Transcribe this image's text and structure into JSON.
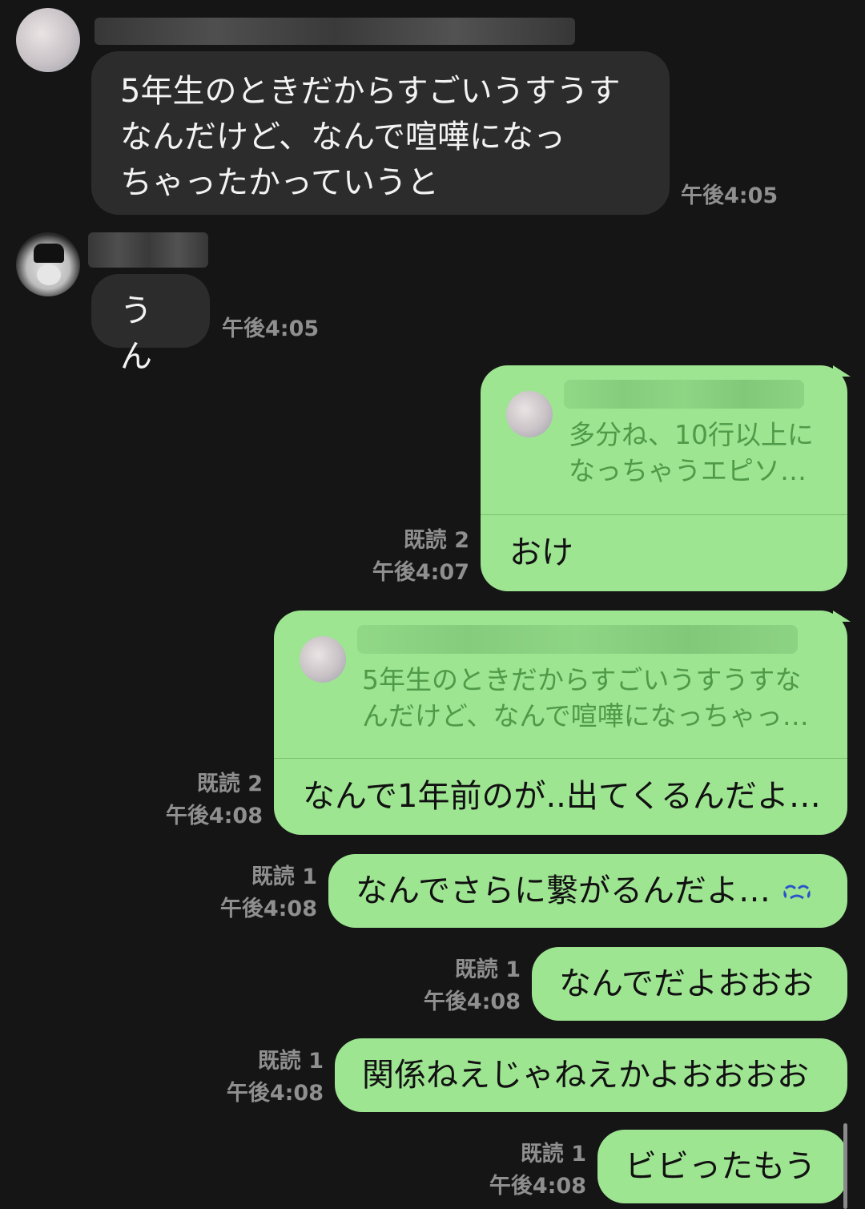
{
  "messages_in": [
    {
      "text": "5年生のときだからすごいうすうす\nなんだけど、なんで喧嘩になっ\nちゃったかっていうと",
      "time": "午後4:05"
    },
    {
      "text": "うん",
      "time": "午後4:05"
    }
  ],
  "messages_out": [
    {
      "quote": "多分ね、10行以上に\nなっちゃうエピソ…",
      "text": "おけ",
      "read": "既読 2",
      "time": "午後4:07"
    },
    {
      "quote": "5年生のときだからすごいうすうすな\nんだけど、なんで喧嘩になっちゃっ…",
      "text": "なんで1年前のが..出てくるんだよ…",
      "read": "既読 2",
      "time": "午後4:08"
    },
    {
      "text": "なんでさらに繋がるんだよ…",
      "icon": "crying-emoji-icon",
      "read": "既読 1",
      "time": "午後4:08"
    },
    {
      "text": "なんでだよおおお",
      "read": "既読 1",
      "time": "午後4:08"
    },
    {
      "text": "関係ねえじゃねえかよおおおお",
      "read": "既読 1",
      "time": "午後4:08"
    },
    {
      "text": "ビビったもう",
      "read": "既読 1",
      "time": "午後4:08"
    }
  ],
  "colors": {
    "background": "#151515",
    "incoming_bubble": "#2c2c2c",
    "outgoing_bubble": "#9ee592",
    "meta_text": "#8f8f8f",
    "quote_text": "#4f9a48"
  }
}
